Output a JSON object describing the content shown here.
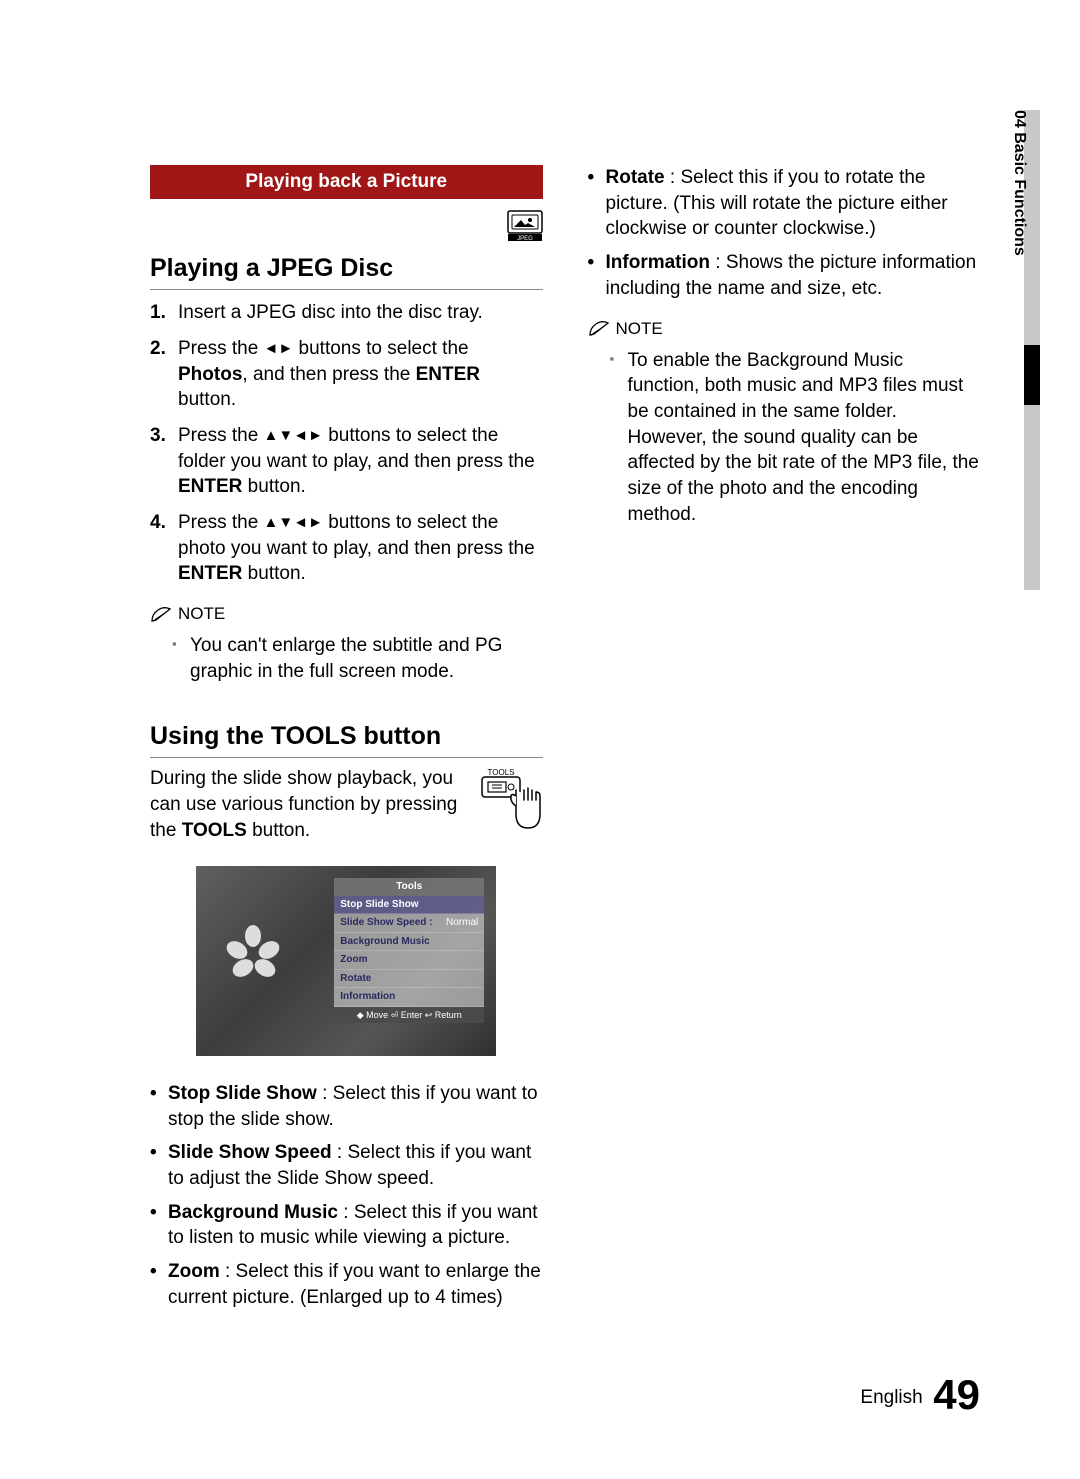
{
  "side_tab": "04  Basic Functions",
  "section_banner": "Playing back a Picture",
  "jpeg_badge_label": "JPEG",
  "heading_1": "Playing a JPEG Disc",
  "steps": [
    {
      "num": "1.",
      "text": "Insert a JPEG disc into the disc tray."
    },
    {
      "num": "2.",
      "text_before": "Press the ",
      "glyph": "◄►",
      "text_mid": " buttons to select the ",
      "bold1": "Photos",
      "text_mid2": ", and then press the ",
      "bold2": "ENTER",
      "text_after": " button."
    },
    {
      "num": "3.",
      "text_before": "Press the ",
      "glyph": "▲▼◄►",
      "text_mid": " buttons to select the folder you want to play, and then press the ",
      "bold1": "ENTER",
      "text_after": " button."
    },
    {
      "num": "4.",
      "text_before": "Press the ",
      "glyph": "▲▼◄►",
      "text_mid": " buttons to select the photo you want to play, and then press the ",
      "bold1": "ENTER",
      "text_after": " button."
    }
  ],
  "note_label": "NOTE",
  "note_1_items": [
    "You can't enlarge the subtitle and PG graphic in the full screen mode."
  ],
  "heading_2": "Using the TOOLS button",
  "tools_intro_before": "During the slide show playback, you can use various function by pressing the ",
  "tools_intro_bold": "TOOLS",
  "tools_intro_after": " button.",
  "tools_button_label": "TOOLS",
  "screenshot_menu": {
    "title": "Tools",
    "items": [
      {
        "label": "Stop Slide Show",
        "value": "",
        "selected": true
      },
      {
        "label": "Slide Show Speed  :",
        "value": "Normal"
      },
      {
        "label": "Background Music",
        "value": ""
      },
      {
        "label": "Zoom",
        "value": ""
      },
      {
        "label": "Rotate",
        "value": ""
      },
      {
        "label": "Information",
        "value": ""
      }
    ],
    "hints": "◆ Move    ⏎ Enter    ↩ Return"
  },
  "tools_options_left": [
    {
      "bold": "Stop Slide Show",
      "text": " : Select this if you want to stop the slide show."
    },
    {
      "bold": "Slide Show Speed",
      "text": " : Select this if you want to adjust the Slide Show speed."
    },
    {
      "bold": "Background Music",
      "text": " : Select this if you want to listen to music while viewing a picture."
    },
    {
      "bold": "Zoom",
      "text": " : Select this if you want to enlarge the current picture. (Enlarged up to 4 times)"
    }
  ],
  "tools_options_right": [
    {
      "bold": "Rotate",
      "text": " : Select this if you to rotate the picture. (This will rotate the picture either clockwise or counter clockwise.)"
    },
    {
      "bold": "Information",
      "text": " : Shows the picture information including the name and size, etc."
    }
  ],
  "note_2_items": [
    "To enable the Background Music function, both music and MP3 files must be contained in the same folder. However, the sound quality can be affected by the bit rate of the MP3 file, the size of the photo and the encoding method."
  ],
  "footer_lang": "English",
  "footer_page": "49"
}
